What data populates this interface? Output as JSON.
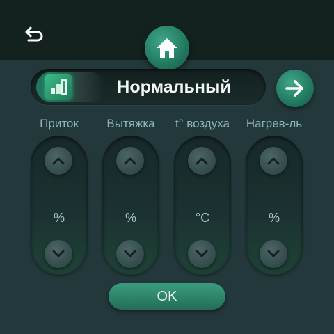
{
  "header": {
    "back_icon": "back-arrow-icon",
    "home_icon": "home-icon"
  },
  "mode": {
    "icon": "signal-bars-icon",
    "label": "Нормальный",
    "next_icon": "arrow-right-icon"
  },
  "columns": [
    {
      "header": "Приток",
      "value": "%"
    },
    {
      "header": "Вытяжка",
      "value": "%"
    },
    {
      "header": "t° воздуха",
      "value": "°C"
    },
    {
      "header": "Нагрев-ль",
      "value": "%"
    }
  ],
  "ok_label": "OK",
  "colors": {
    "background": "#23383b",
    "topbar": "#13211f",
    "accent": "#2a8a6e",
    "text": "#9fc3c4"
  }
}
